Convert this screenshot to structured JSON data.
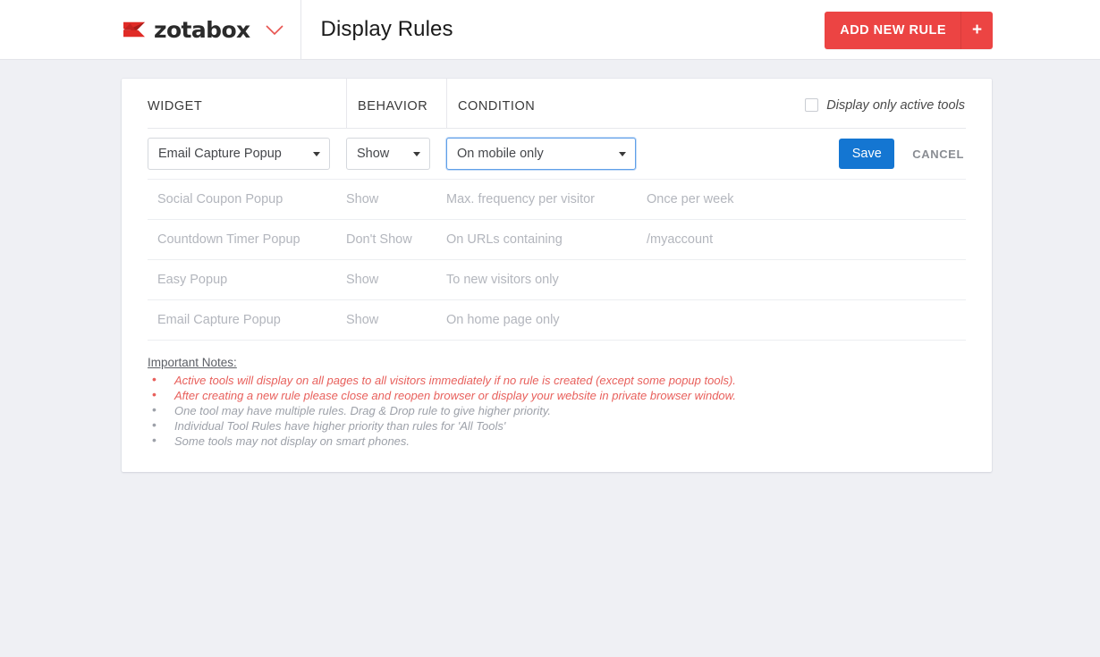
{
  "topbar": {
    "logo_word": "zotabox",
    "logo_icon": "zotabox-z-logo",
    "brand_caret_icon": "chevron-down-icon",
    "page_title": "Display Rules",
    "add_rule_label": "ADD NEW RULE",
    "add_rule_plus": "+",
    "brand_color": "#ec4443"
  },
  "table": {
    "headers": {
      "widget": "WIDGET",
      "behavior": "BEHAVIOR",
      "condition": "CONDITION"
    },
    "active_only_label": "Display only active tools",
    "active_only_checked": false,
    "edit_row": {
      "widget_value": "Email Capture Popup",
      "behavior_value": "Show",
      "condition_value": "On mobile only",
      "save_label": "Save",
      "cancel_label": "CANCEL",
      "save_color": "#1476d2",
      "focused_field": "condition"
    },
    "rows": [
      {
        "widget": "Social Coupon Popup",
        "behavior": "Show",
        "condition": "Max. frequency per visitor",
        "value": "Once per week"
      },
      {
        "widget": "Countdown Timer Popup",
        "behavior": "Don't Show",
        "condition": "On URLs containing",
        "value": "/myaccount"
      },
      {
        "widget": "Easy Popup",
        "behavior": "Show",
        "condition": "To new visitors only",
        "value": ""
      },
      {
        "widget": "Email Capture Popup",
        "behavior": "Show",
        "condition": "On home page only",
        "value": ""
      }
    ]
  },
  "notes": {
    "title": "Important Notes:",
    "items": [
      {
        "text": "Active tools will display on all pages to all visitors immediately if no rule is created (except some popup tools).",
        "color": "#e8605c"
      },
      {
        "text": "After creating a new rule please close and reopen browser or display your website in private browser window.",
        "color": "#e8605c"
      },
      {
        "text": "One tool may have multiple rules. Drag & Drop rule to give higher priority.",
        "color": "#9da1a9"
      },
      {
        "text": "Individual Tool Rules have higher priority than rules for 'All Tools'",
        "color": "#9da1a9"
      },
      {
        "text": "Some tools may not display on smart phones.",
        "color": "#9da1a9"
      }
    ]
  }
}
